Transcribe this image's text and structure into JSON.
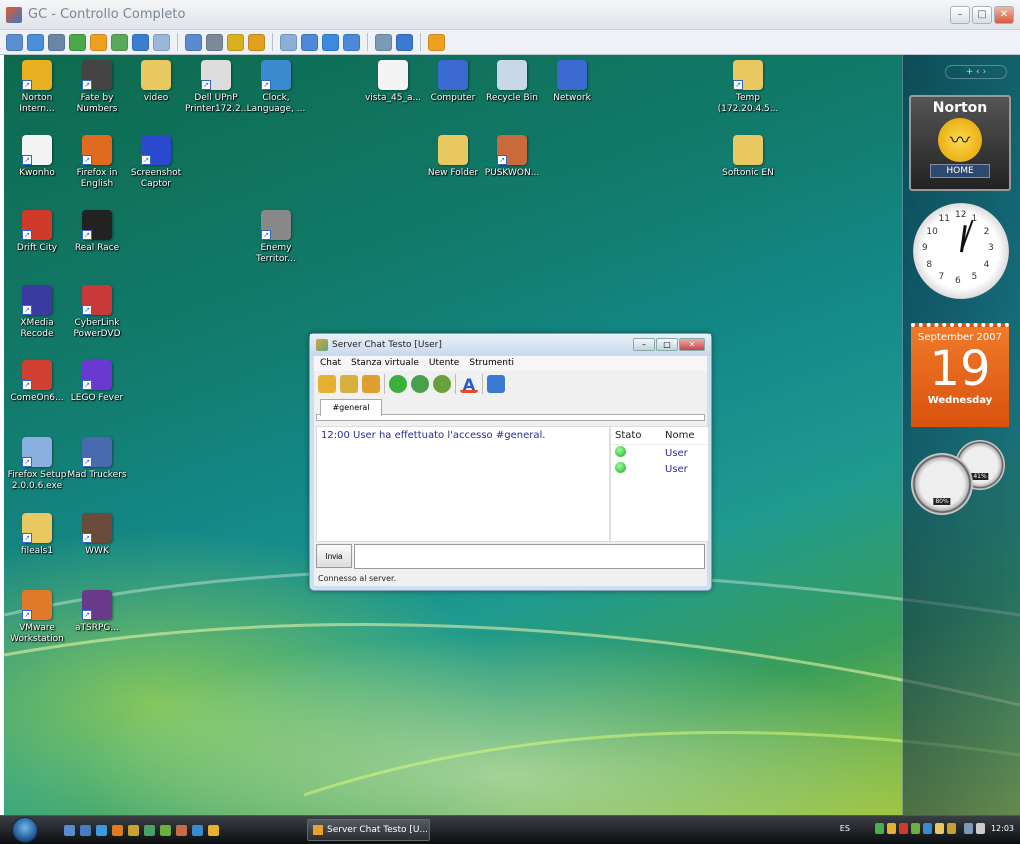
{
  "window": {
    "title": "GC - Controllo Completo",
    "minimize": "–",
    "maximize": "□",
    "close": "✕"
  },
  "toolbar": {
    "icons": [
      "monitor-icon",
      "screen-icon",
      "terminal-icon",
      "transfer-icon",
      "message-icon",
      "chat-icon",
      "phone-icon",
      "balloon-icon",
      "upload-icon",
      "network-icon",
      "lock-icon",
      "unlock-icon",
      "window-icon",
      "fit-icon",
      "fullscreen-icon",
      "scale-icon",
      "copy-icon",
      "tools-icon",
      "close-session-icon"
    ],
    "colors": [
      "#5b8fd1",
      "#4a90d9",
      "#6a86a6",
      "#4aa84a",
      "#f0a020",
      "#5aa85a",
      "#3a7ed0",
      "#9ab8da",
      "#5a8ad0",
      "#7a8a9a",
      "#d8b020",
      "#e0a020",
      "#8ab0d8",
      "#4a8ad8",
      "#3a8ae0",
      "#4a8ad8",
      "#7a9ab8",
      "#3a7ad0",
      "#f0a020"
    ]
  },
  "desktop": {
    "icons": [
      {
        "label": "Norton Intern...",
        "color": "#e8b020"
      },
      {
        "label": "Fate by Numbers",
        "color": "#444444"
      },
      {
        "label": "video",
        "color": "#e8c860"
      },
      {
        "label": "Dell UPnP Printer172.2...",
        "color": "#dddddd"
      },
      {
        "label": "Clock, Language, ...",
        "color": "#3a8ad0"
      },
      {
        "label": "vista_45_a...",
        "color": "#f4f4f4"
      },
      {
        "label": "Computer",
        "color": "#3a6ad0"
      },
      {
        "label": "Recycle Bin",
        "color": "#c8d8e8"
      },
      {
        "label": "Network",
        "color": "#3a6ad0"
      },
      {
        "label": "Temp (172.20.4.5...",
        "color": "#e8c860"
      },
      {
        "label": "Kwonho",
        "color": "#f4f4f4"
      },
      {
        "label": "Firefox in English",
        "color": "#e06a20"
      },
      {
        "label": "Screenshot Captor",
        "color": "#2a4ad0"
      },
      {
        "label": "New Folder",
        "color": "#e8c860"
      },
      {
        "label": "PUSKWON...",
        "color": "#c86a3a"
      },
      {
        "label": "Softonic EN",
        "color": "#e8c860"
      },
      {
        "label": "Drift City",
        "color": "#d03a2a"
      },
      {
        "label": "Real Race",
        "color": "#222222"
      },
      {
        "label": "Enemy Territor...",
        "color": "#888888"
      },
      {
        "label": "XMedia Recode",
        "color": "#3a3aa0"
      },
      {
        "label": "CyberLink PowerDVD",
        "color": "#c83a3a"
      },
      {
        "label": "ComeOn6...",
        "color": "#d04030"
      },
      {
        "label": "LEGO Fever",
        "color": "#6a3ad0"
      },
      {
        "label": "Firefox Setup 2.0.0.6.exe",
        "color": "#8ab0e0"
      },
      {
        "label": "Mad Truckers",
        "color": "#4a6ab0"
      },
      {
        "label": "fileals1",
        "color": "#e8c860"
      },
      {
        "label": "WWK",
        "color": "#6a4a3a"
      },
      {
        "label": "VMware Workstation",
        "color": "#e07a2a"
      },
      {
        "label": "aTSRPG...",
        "color": "#6a3a8a"
      }
    ]
  },
  "gadgets": {
    "controls": "+  ‹ ›",
    "norton": {
      "brand": "Norton",
      "button": "HOME"
    },
    "clock": {
      "numbers": [
        "12",
        "1",
        "2",
        "3",
        "4",
        "5",
        "6",
        "7",
        "8",
        "9",
        "10",
        "11"
      ]
    },
    "calendar": {
      "month": "September 2007",
      "day": "19",
      "weekday": "Wednesday",
      "color": "#e8621a"
    },
    "meter": {
      "cpu": "80%",
      "mem": "41%"
    }
  },
  "chat": {
    "title": "Server Chat Testo [User]",
    "menu": [
      "Chat",
      "Stanza virtuale",
      "Utente",
      "Strumenti"
    ],
    "tab": "#general",
    "messages": [
      "12:00 User ha effettuato l'accesso #general."
    ],
    "users_header": {
      "status": "Stato",
      "name": "Nome"
    },
    "users": [
      {
        "name": "User"
      },
      {
        "name": "User"
      }
    ],
    "send_label": "Invia",
    "input_value": "",
    "status": "Connesso al server."
  },
  "taskbar": {
    "task": "Server Chat Testo [U...",
    "language": "ES",
    "time": "12:03"
  }
}
